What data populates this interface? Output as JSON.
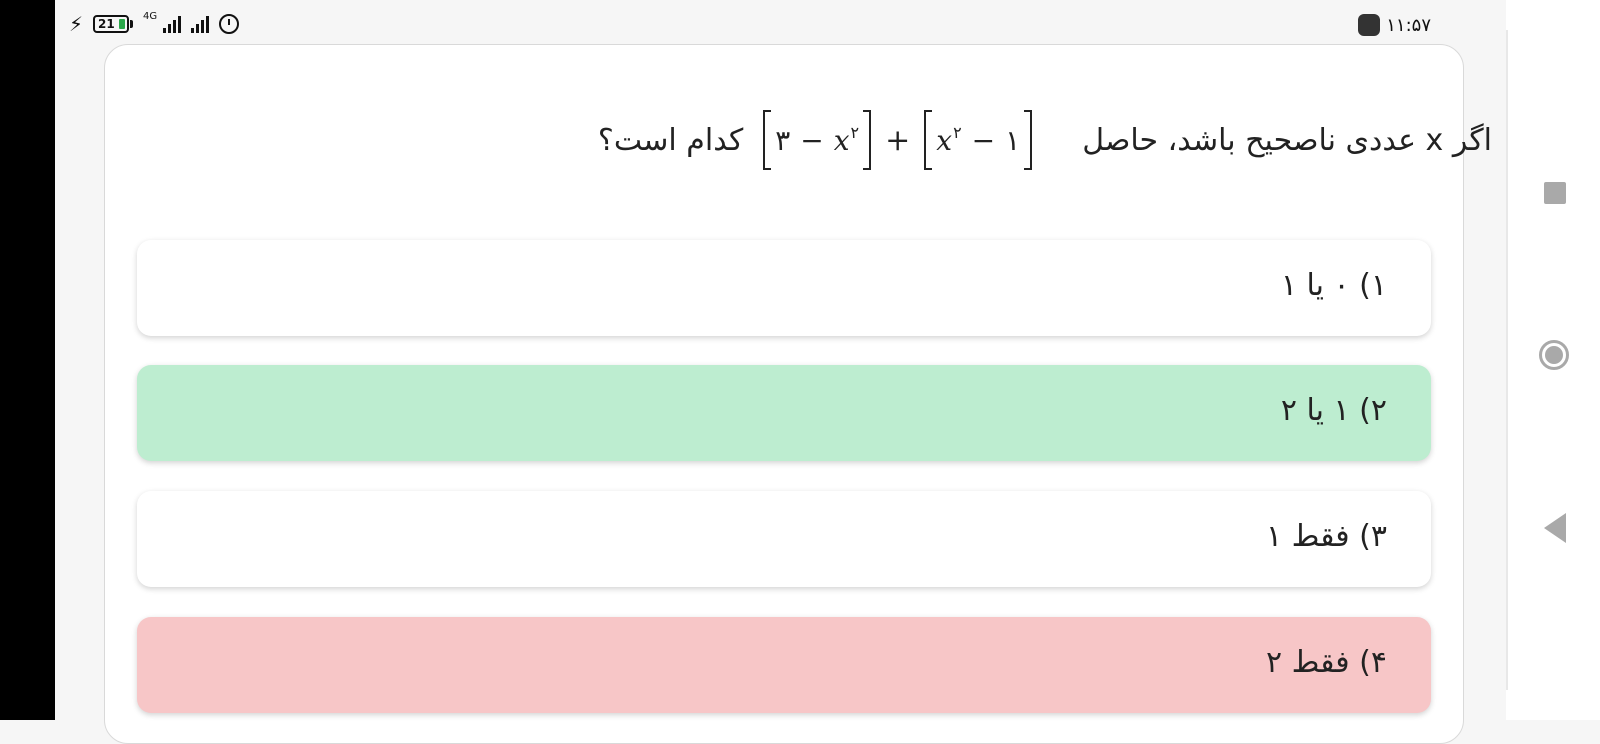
{
  "status_bar": {
    "battery_percent": "21",
    "network_label": "4G",
    "time": "۱۱:۵۷"
  },
  "question": {
    "text_before": "اگر x عددی ناصحیح باشد، حاصل",
    "text_after": "کدام است؟",
    "formula": {
      "term1_const": "۳",
      "term1_var": "x",
      "term1_exp": "۲",
      "operator_minus": "−",
      "plus": "+",
      "term2_var": "x",
      "term2_exp": "۲",
      "term2_const": "۱"
    }
  },
  "options": [
    {
      "label": "۱) ۰ یا ۱",
      "state": "neutral"
    },
    {
      "label": "۲) ۱ یا ۲",
      "state": "correct"
    },
    {
      "label": "۳) فقط ۱",
      "state": "neutral"
    },
    {
      "label": "۴) فقط ۲",
      "state": "wrong"
    }
  ],
  "colors": {
    "correct": "#bdedd0",
    "wrong": "#f7c6c7",
    "neutral": "#ffffff"
  },
  "nav_icons": [
    "recents-square-icon",
    "home-circle-icon",
    "back-triangle-icon"
  ]
}
